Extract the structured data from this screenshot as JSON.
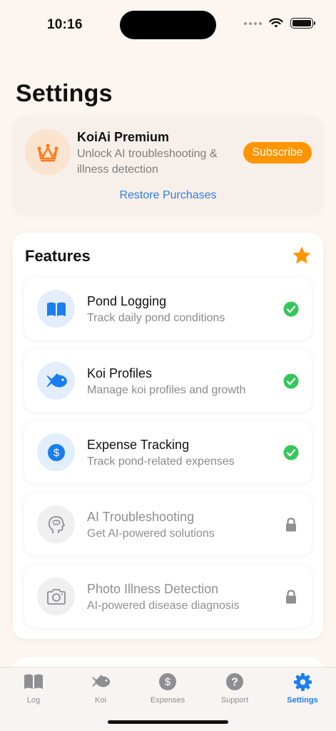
{
  "status_bar": {
    "time": "10:16"
  },
  "page": {
    "title": "Settings"
  },
  "premium": {
    "title": "KoiAi Premium",
    "subtitle": "Unlock AI troubleshooting & illness detection",
    "subscribe_label": "Subscribe",
    "restore_label": "Restore Purchases"
  },
  "features": {
    "title": "Features",
    "items": [
      {
        "name": "Pond Logging",
        "description": "Track daily pond conditions",
        "icon": "book-icon",
        "status": "enabled"
      },
      {
        "name": "Koi Profiles",
        "description": "Manage koi profiles and growth",
        "icon": "fish-icon",
        "status": "enabled"
      },
      {
        "name": "Expense Tracking",
        "description": "Track pond-related expenses",
        "icon": "dollar-icon",
        "status": "enabled"
      },
      {
        "name": "AI Troubleshooting",
        "description": "Get AI-powered solutions",
        "icon": "brain-head-icon",
        "status": "locked"
      },
      {
        "name": "Photo Illness Detection",
        "description": "AI-powered disease diagnosis",
        "icon": "camera-icon",
        "status": "locked"
      }
    ]
  },
  "tab_bar": {
    "tabs": [
      {
        "label": "Log",
        "icon": "book-icon",
        "active": false
      },
      {
        "label": "Koi",
        "icon": "fish-icon",
        "active": false
      },
      {
        "label": "Expenses",
        "icon": "dollar-icon",
        "active": false
      },
      {
        "label": "Support",
        "icon": "question-icon",
        "active": false
      },
      {
        "label": "Settings",
        "icon": "gear-icon",
        "active": true
      }
    ]
  },
  "colors": {
    "accent": "#1a7ef0",
    "premium": "#ff9500",
    "enabled": "#34c759",
    "locked": "#8e8e93"
  }
}
